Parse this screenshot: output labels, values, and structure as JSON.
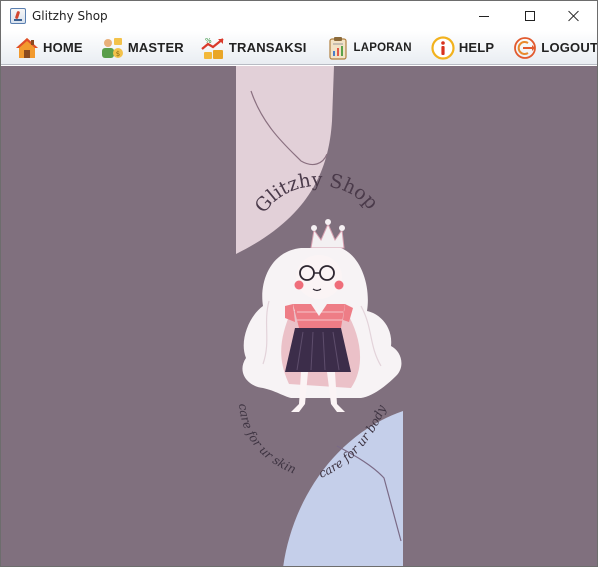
{
  "window": {
    "title": "Glitzhy Shop",
    "controls": {
      "minimize": "minimize",
      "maximize": "maximize",
      "close": "close"
    }
  },
  "menu": {
    "items": [
      {
        "label": "HOME",
        "icon": "house-icon"
      },
      {
        "label": "MASTER",
        "icon": "people-icon"
      },
      {
        "label": "TRANSAKSI",
        "icon": "coins-chart-icon"
      },
      {
        "label": "LAPORAN",
        "icon": "clipboard-report-icon"
      },
      {
        "label": "HELP",
        "icon": "info-icon"
      },
      {
        "label": "LOGOUT",
        "icon": "logout-icon"
      }
    ]
  },
  "banner": {
    "brand_text": "Glitzhy Shop",
    "tagline_left": "care for ur skin",
    "tagline_right": "care for ur body"
  },
  "colors": {
    "background": "#80707e",
    "shape_pink": "#e2d0d8",
    "shape_blue": "#c5cfea",
    "shirt": "#ee7d86",
    "skirt": "#3c2d4a"
  }
}
